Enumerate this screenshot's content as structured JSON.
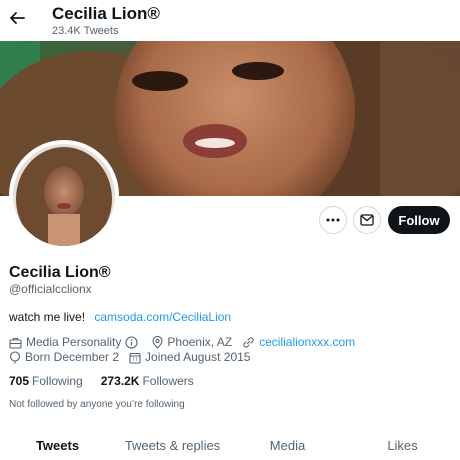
{
  "header": {
    "title": "Cecilia Lion®",
    "tweet_count": "23.4K Tweets"
  },
  "profile": {
    "name": "Cecilia Lion®",
    "handle": "@officialcclionx",
    "bio_text": "watch me live!",
    "bio_link": "camsoda.com/CeciliaLion",
    "category": "Media Personality",
    "location": "Phoenix, AZ",
    "website": "cecilialionxxx.com",
    "birthday": "Born December 2",
    "joined": "Joined August 2015",
    "following_count": "705",
    "following_label": "Following",
    "followers_count": "273.2K",
    "followers_label": "Followers",
    "followed_by_note": "Not followed by anyone you’re following"
  },
  "actions": {
    "follow_label": "Follow"
  },
  "tabs": [
    {
      "label": "Tweets",
      "active": true
    },
    {
      "label": "Tweets & replies",
      "active": false
    },
    {
      "label": "Media",
      "active": false
    },
    {
      "label": "Likes",
      "active": false
    }
  ],
  "colors": {
    "link": "#1d9bf0",
    "secondary_text": "#536471",
    "primary_text": "#0f1419"
  },
  "icons": [
    "back-arrow-icon",
    "more-icon",
    "mail-icon",
    "briefcase-icon",
    "info-icon",
    "location-icon",
    "link-icon",
    "birthday-icon",
    "calendar-icon"
  ]
}
